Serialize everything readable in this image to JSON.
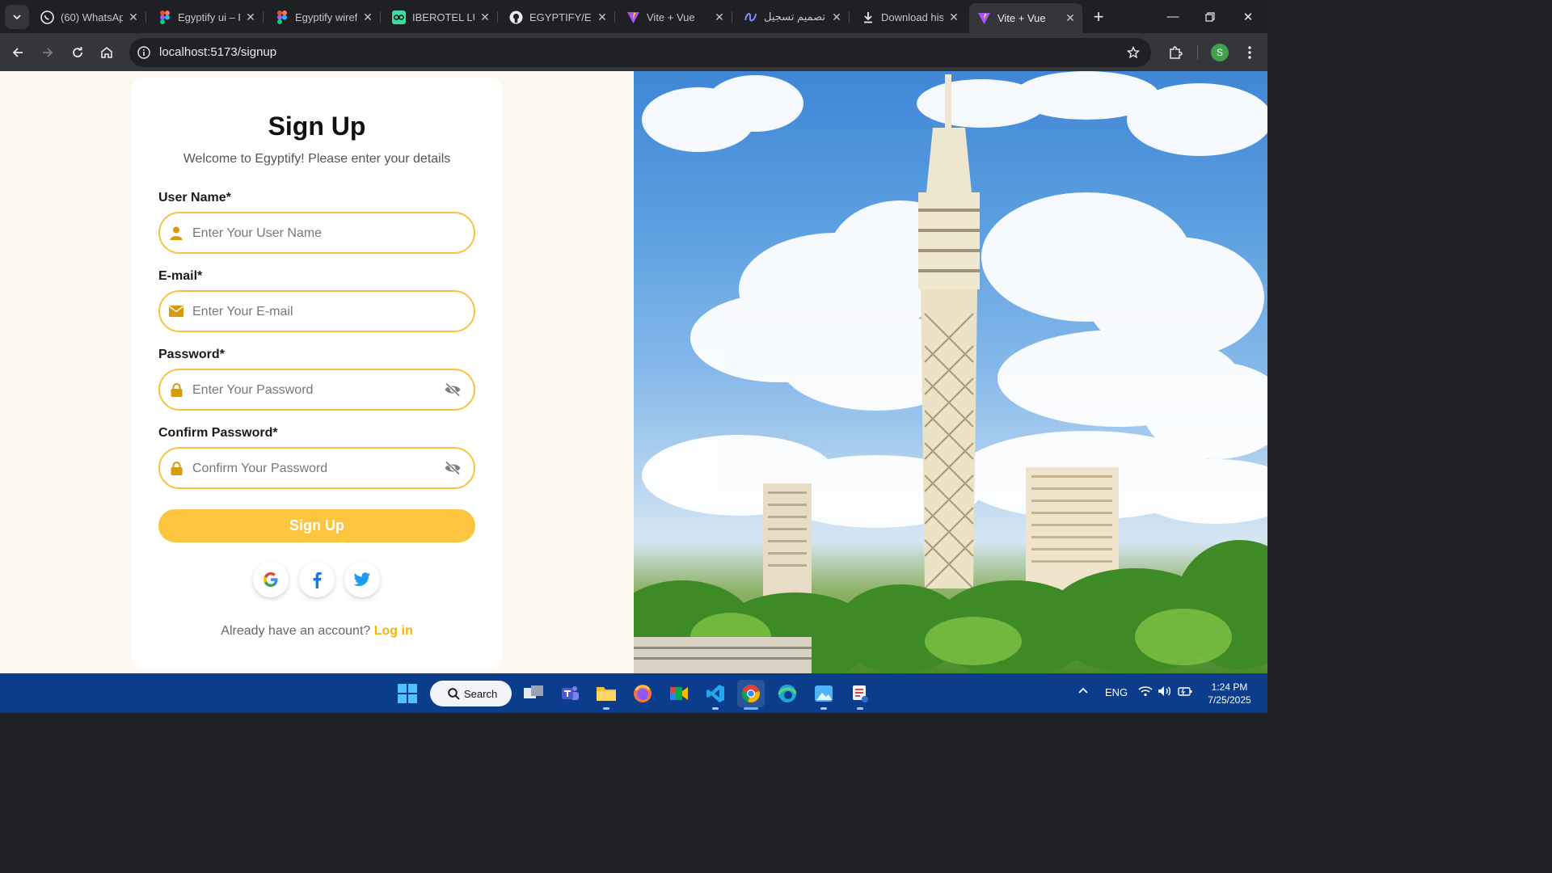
{
  "browser": {
    "tabs": [
      {
        "title": "(60) WhatsAp",
        "icon": "whatsapp-icon"
      },
      {
        "title": "Egyptify ui – F",
        "icon": "figma-icon"
      },
      {
        "title": "Egyptify wiref",
        "icon": "figma-icon"
      },
      {
        "title": "IBEROTEL LUX",
        "icon": "tripadvisor-icon"
      },
      {
        "title": "EGYPTIFY/Egy",
        "icon": "github-icon"
      },
      {
        "title": "Vite + Vue",
        "icon": "vite-icon"
      },
      {
        "title": "تصميم تسجيل",
        "icon": "ai-chat-icon"
      },
      {
        "title": "Download his",
        "icon": "download-icon"
      },
      {
        "title": "Vite + Vue",
        "icon": "vite-icon",
        "active": true
      }
    ],
    "url": "localhost:5173/signup",
    "profile_initial": "S"
  },
  "page": {
    "title": "Sign Up",
    "subtitle": "Welcome to Egyptify! Please enter your details",
    "fields": {
      "username": {
        "label": "User Name*",
        "placeholder": "Enter Your User Name",
        "value": ""
      },
      "email": {
        "label": "E-mail*",
        "placeholder": "Enter Your E-mail",
        "value": ""
      },
      "password": {
        "label": "Password*",
        "placeholder": "Enter Your Password",
        "value": ""
      },
      "confirm": {
        "label": "Confirm Password*",
        "placeholder": "Confirm Your Password",
        "value": ""
      }
    },
    "submit_label": "Sign Up",
    "social": [
      "google-icon",
      "facebook-icon",
      "twitter-icon"
    ],
    "footer_text": "Already have an account?",
    "footer_link": "Log in",
    "colors": {
      "accent": "#f5c242",
      "button": "#fdc43f",
      "icon": "#d99a0b",
      "link": "#f4b400",
      "background": "#fdf8f2"
    }
  },
  "taskbar": {
    "search_label": "Search",
    "language": "ENG",
    "time": "1:24 PM",
    "date": "7/25/2025"
  }
}
